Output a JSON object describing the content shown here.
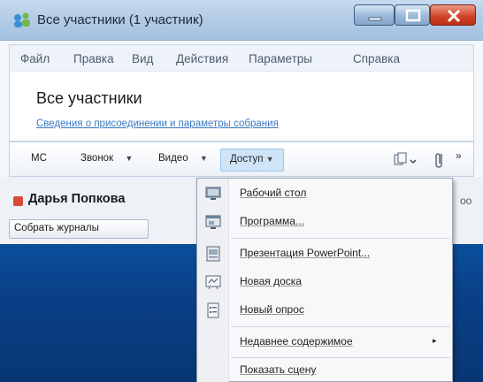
{
  "window": {
    "title": "Все участники (1 участник)"
  },
  "menu": {
    "items": [
      "Файл",
      "Правка",
      "Вид",
      "Действия",
      "Параметры",
      "Справка"
    ]
  },
  "header": {
    "title": "Все участники",
    "link": "Сведения о присоединении и параметры собрания"
  },
  "toolbar": {
    "mc": "МС",
    "call": "Звонок",
    "video": "Видео",
    "share": "Доступ",
    "arrow": "▼",
    "more": "»"
  },
  "participants": {
    "name": "Дарья Попкова",
    "presence_color": "#d94a38",
    "partial_right": "оо",
    "collect_logs": "Собрать журналы"
  },
  "share_menu": {
    "items": [
      {
        "label": "Рабочий стол",
        "icon": "desktop-icon"
      },
      {
        "label": "Программа...",
        "icon": "program-icon"
      },
      {
        "label": "Презентация PowerPoint...",
        "icon": "powerpoint-icon"
      },
      {
        "label": "Новая доска",
        "icon": "whiteboard-icon"
      },
      {
        "label": "Новый опрос",
        "icon": "poll-icon"
      },
      {
        "label": "Недавнее содержимое",
        "icon": ""
      },
      {
        "label": "Показать сцену",
        "icon": ""
      }
    ],
    "submenu_arrow": "▸"
  },
  "colors": {
    "accent": "#cfe5f7",
    "desktop": "#0a4f9c",
    "close": "#d2462a"
  }
}
